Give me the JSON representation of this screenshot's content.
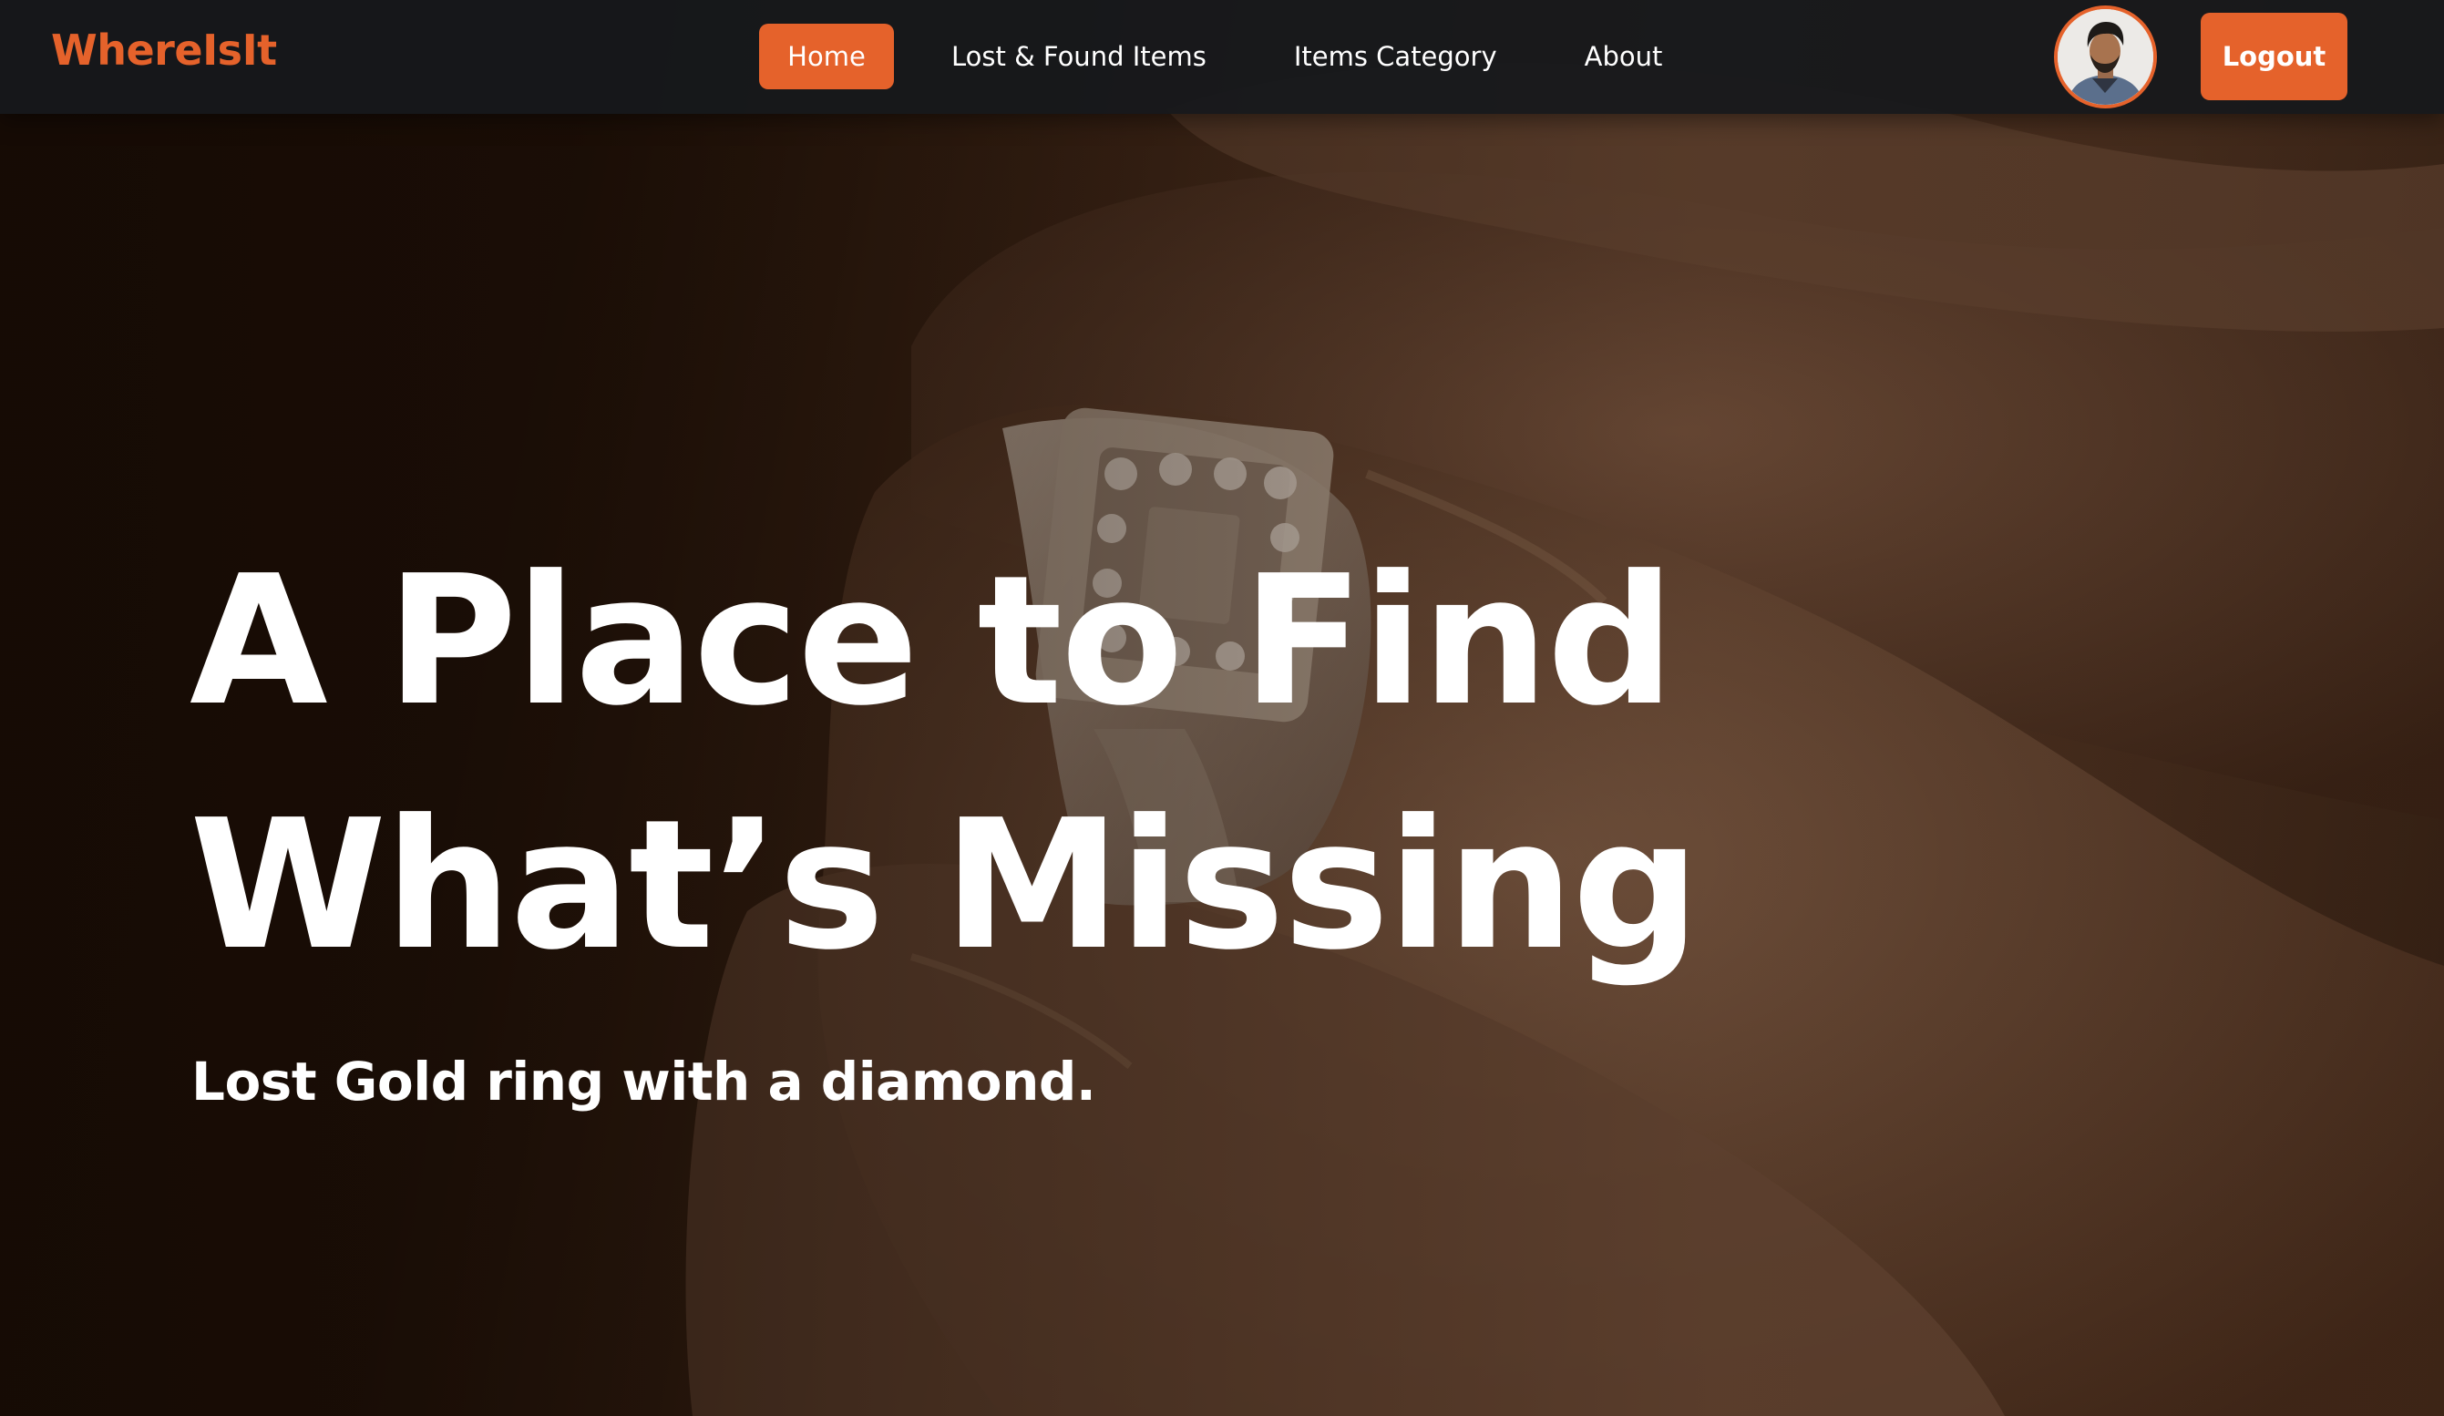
{
  "brand": {
    "name": "WhereIsIt"
  },
  "nav": {
    "items": [
      {
        "label": "Home",
        "active": true
      },
      {
        "label": "Lost & Found Items",
        "active": false
      },
      {
        "label": "Items Category",
        "active": false
      },
      {
        "label": "About",
        "active": false
      }
    ]
  },
  "user": {
    "avatar_icon": "user-avatar",
    "logout_label": "Logout"
  },
  "hero": {
    "title": "A Place to Find What’s Missing",
    "subtitle": "Lost Gold ring with a diamond."
  },
  "colors": {
    "accent": "#e5622b",
    "navbar_bg": "#16181c",
    "text": "#ffffff"
  }
}
